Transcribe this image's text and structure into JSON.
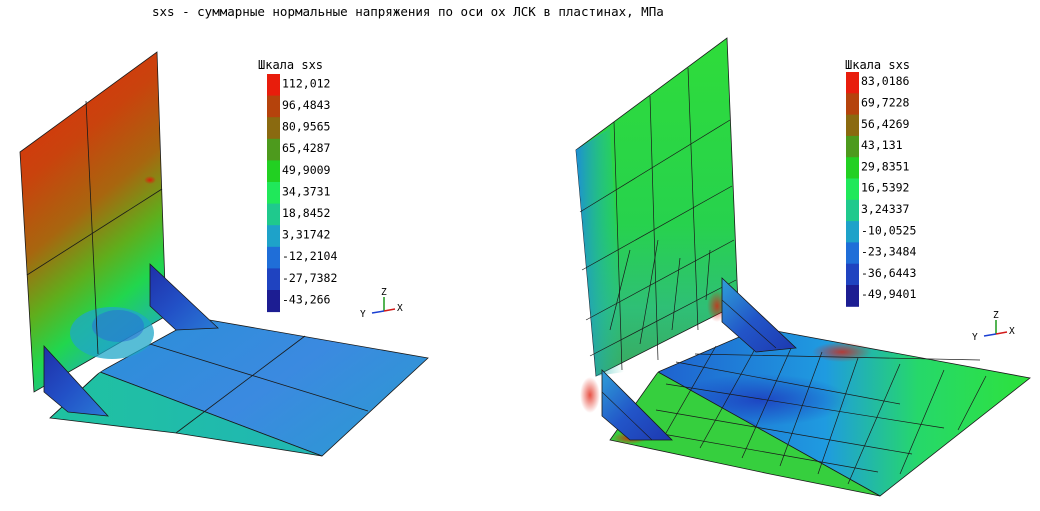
{
  "title": "sxs - суммарные нормальные напряжения по оси ox ЛСК в пластинах, МПа",
  "left_model": {
    "scale_title": "Шкала sxs",
    "scale_values": [
      "112,012",
      "96,4843",
      "80,9565",
      "65,4287",
      "49,9009",
      "34,3731",
      "18,8452",
      "3,31742",
      "-12,2104",
      "-27,7382",
      "-43,266"
    ],
    "axis_labels": {
      "z": "Z",
      "y": "Y",
      "x": "X"
    }
  },
  "right_model": {
    "scale_title": "Шкала sxs",
    "scale_values": [
      "83,0186",
      "69,7228",
      "56,4269",
      "43,131",
      "29,8351",
      "16,5392",
      "3,24337",
      "-10,0525",
      "-23,3484",
      "-36,6443",
      "-49,9401"
    ],
    "axis_labels": {
      "z": "Z",
      "y": "Y",
      "x": "X"
    }
  },
  "colors": {
    "scale": [
      "#e81d0c",
      "#b5430c",
      "#8a6a10",
      "#4d9a1d",
      "#22d022",
      "#20e85a",
      "#1fc98d",
      "#1ea2c9",
      "#1f6ed8",
      "#1f43c0",
      "#1c1d92"
    ],
    "mesh_line": "#1a1a1a",
    "axis_x": "#d21a1a",
    "axis_y": "#1a3fd2",
    "axis_z": "#1a9a1a"
  }
}
